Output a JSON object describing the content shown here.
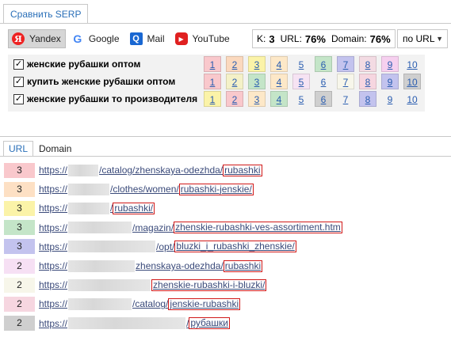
{
  "top_tab": {
    "label": "Сравнить SERP"
  },
  "engines": [
    {
      "label": "Yandex",
      "icon": "yandex-icon",
      "glyph": "Я",
      "active": true
    },
    {
      "label": "Google",
      "icon": "google-icon",
      "glyph": "G",
      "active": false
    },
    {
      "label": "Mail",
      "icon": "mail-icon",
      "glyph": "Q",
      "active": false
    },
    {
      "label": "YouTube",
      "icon": "youtube-icon",
      "glyph": "▶",
      "active": false
    }
  ],
  "stats": {
    "k_label": "K:",
    "k_value": "3",
    "url_label": "URL:",
    "url_value": "76%",
    "domain_label": "Domain:",
    "domain_value": "76%"
  },
  "sort_select": {
    "value": "по URL"
  },
  "check_glyph": "✓",
  "queries": [
    {
      "text": "женские рубашки оптом",
      "checked": true,
      "cells": [
        {
          "n": "1",
          "color": "#f9c8cc"
        },
        {
          "n": "2",
          "color": "#fbd9be"
        },
        {
          "n": "3",
          "color": "#fbf3a8"
        },
        {
          "n": "4",
          "color": "#fde8c8"
        },
        {
          "n": "5",
          "color": ""
        },
        {
          "n": "6",
          "color": "#c4e5c8"
        },
        {
          "n": "7",
          "color": "#c3c3ee"
        },
        {
          "n": "8",
          "color": "#f3dbe3"
        },
        {
          "n": "9",
          "color": "#f6d0ef"
        },
        {
          "n": "10",
          "color": ""
        }
      ]
    },
    {
      "text": "купить женские рубашки оптом",
      "checked": true,
      "cells": [
        {
          "n": "1",
          "color": "#f9c8cc"
        },
        {
          "n": "2",
          "color": "#f4f1c8"
        },
        {
          "n": "3",
          "color": "#c4e5c8"
        },
        {
          "n": "4",
          "color": "#fde8c8"
        },
        {
          "n": "5",
          "color": "#f6e3f3"
        },
        {
          "n": "6",
          "color": ""
        },
        {
          "n": "7",
          "color": "#f7f6ea"
        },
        {
          "n": "8",
          "color": "#f6d6e0"
        },
        {
          "n": "9",
          "color": "#c3c3ee"
        },
        {
          "n": "10",
          "color": "#cfcfcf"
        }
      ]
    },
    {
      "text": "женские рубашки то производителя",
      "checked": true,
      "cells": [
        {
          "n": "1",
          "color": "#fbf3a8"
        },
        {
          "n": "2",
          "color": "#f9c8cc"
        },
        {
          "n": "3",
          "color": "#fde8c8"
        },
        {
          "n": "4",
          "color": "#c4e5c8"
        },
        {
          "n": "5",
          "color": ""
        },
        {
          "n": "6",
          "color": "#cfcfcf"
        },
        {
          "n": "7",
          "color": ""
        },
        {
          "n": "8",
          "color": "#c3c3ee"
        },
        {
          "n": "9",
          "color": ""
        },
        {
          "n": "10",
          "color": ""
        }
      ]
    }
  ],
  "lower_tabs": [
    {
      "label": "URL",
      "active": true
    },
    {
      "label": "Domain",
      "active": false
    }
  ],
  "urls": [
    {
      "count": "3",
      "color": "#f9c8cc",
      "prefix": "https://",
      "blur": 38,
      "path": "/catalog/zhenskaya-odezhda/",
      "hl": "rubashki"
    },
    {
      "count": "3",
      "color": "#fde0c4",
      "prefix": "https://",
      "blur": 52,
      "path": "/clothes/women/",
      "hl": "rubashki-jenskie/"
    },
    {
      "count": "3",
      "color": "#fbf3a8",
      "prefix": "https://",
      "blur": 52,
      "path": "/",
      "hl": "rubashki/"
    },
    {
      "count": "3",
      "color": "#c4e5c8",
      "prefix": "https://",
      "blur": 80,
      "path": "/magazin/",
      "hl": "zhenskie-rubashki-ves-assortiment.htm"
    },
    {
      "count": "3",
      "color": "#c3c3ee",
      "prefix": "https://",
      "blur": 110,
      "path": "/opt/",
      "hl": "bluzki_i_rubashki_zhenskie/"
    },
    {
      "count": "2",
      "color": "#f6e0f4",
      "prefix": "https://",
      "blur": 84,
      "path": "zhenskaya-odezhda/",
      "hl": "rubashki"
    },
    {
      "count": "2",
      "color": "#f7f6ea",
      "prefix": "https://",
      "blur": 104,
      "path": "",
      "hl": "zhenskie-rubashki-i-bluzki/"
    },
    {
      "count": "2",
      "color": "#f6d6e0",
      "prefix": "https://",
      "blur": 80,
      "path": "/catalog/",
      "hl": "jenskie-rubashki"
    },
    {
      "count": "2",
      "color": "#cfcfcf",
      "prefix": "https://",
      "blur": 148,
      "path": "/",
      "hl": "рубашки"
    }
  ]
}
